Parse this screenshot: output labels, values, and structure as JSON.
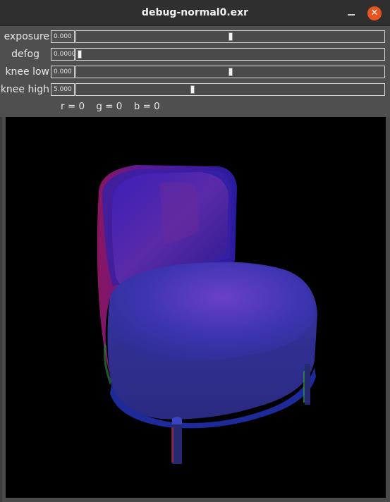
{
  "window": {
    "title": "debug-normal0.exr",
    "minimize_icon": "minimize-icon",
    "close_icon": "close-icon",
    "close_glyph": "✕",
    "close_color": "#e95420"
  },
  "controls": [
    {
      "label": "exposure",
      "value": "0.000",
      "level": 0.5
    },
    {
      "label": "defog",
      "value": "0.0000",
      "level": 0.0
    },
    {
      "label": "knee low",
      "value": "0.000",
      "level": 0.5
    },
    {
      "label": "knee high",
      "value": "5.000",
      "level": 0.375
    }
  ],
  "pixel_readout": {
    "r": "r = 0",
    "g": "g = 0",
    "b": "b = 0"
  },
  "viewport": {
    "background": "#000000",
    "content": "chair-normal-map-image"
  }
}
